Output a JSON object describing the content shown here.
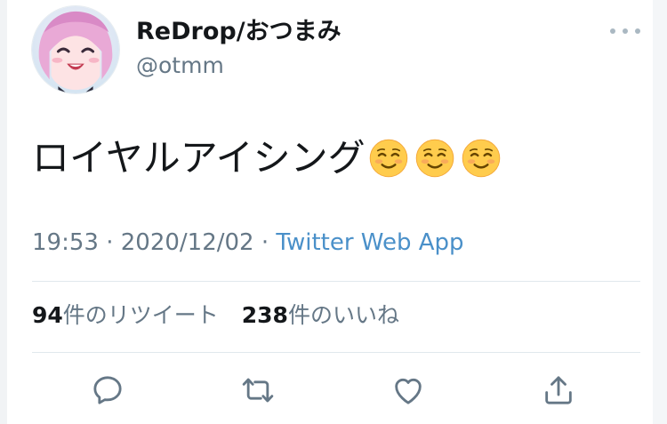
{
  "tweet": {
    "display_name": "ReDrop/おつまみ",
    "handle": "@otmm",
    "text": "ロイヤルアイシング",
    "emoji_name": "smiling-face-emoji",
    "emoji_count": 3,
    "time": "19:53",
    "separator": "·",
    "date": "2020/12/02",
    "source": "Twitter Web App",
    "retweet_count": "94",
    "retweet_label": "件のリツイート",
    "like_count": "238",
    "like_label": "件のいいね"
  },
  "actions": [
    {
      "icon": "reply-icon"
    },
    {
      "icon": "retweet-icon"
    },
    {
      "icon": "like-icon"
    },
    {
      "icon": "share-icon"
    }
  ],
  "colors": {
    "text": "#14171a",
    "secondary": "#657786",
    "link": "#4a90c9",
    "divider": "#e1e8ed",
    "icon": "#657786"
  }
}
